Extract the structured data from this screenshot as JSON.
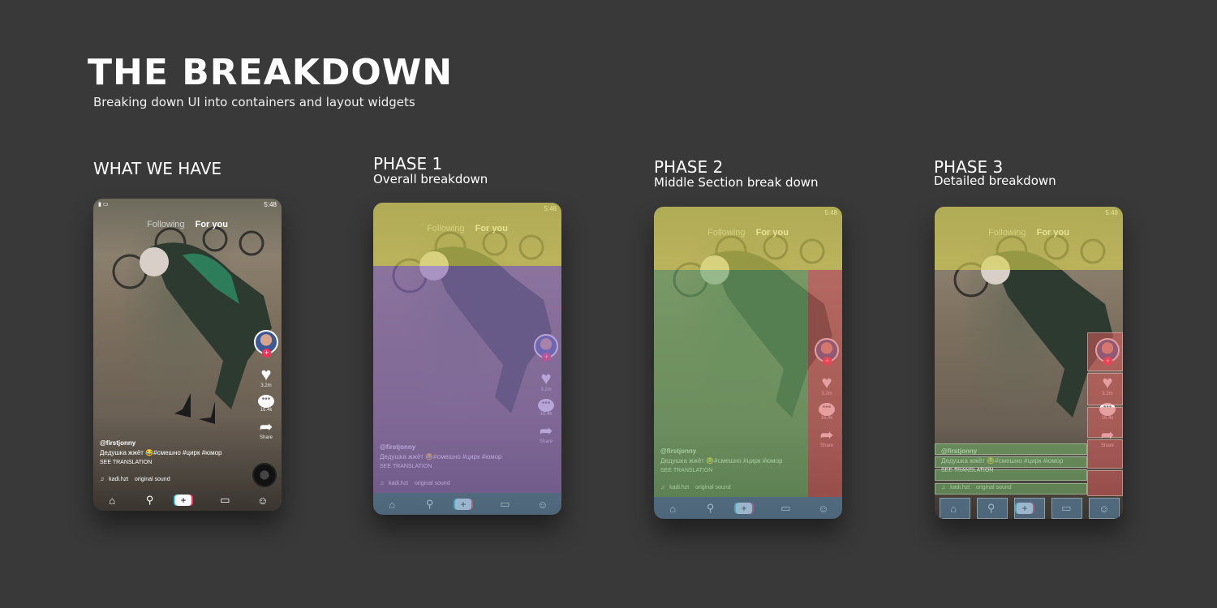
{
  "header": {
    "title": "THE BREAKDOWN",
    "subtitle": "Breaking down UI into containers and layout widgets"
  },
  "columns": [
    {
      "heading": "WHAT WE HAVE",
      "sub": ""
    },
    {
      "heading": "PHASE 1",
      "sub": "Overall breakdown"
    },
    {
      "heading": "PHASE 2",
      "sub": "Middle Section break down"
    },
    {
      "heading": "PHASE 3",
      "sub": "Detailed breakdown"
    }
  ],
  "phone": {
    "time": "5:48",
    "tab_following": "Following",
    "tab_for_you": "For you",
    "likes": "3.2m",
    "comments": "16.4k",
    "share": "Share",
    "username": "@firstjonny",
    "caption": "Дедушка жжёт 😂#смешно #цирк #юмор",
    "see_translation": "SEE TRANSLATION",
    "music_user": "kadi.hzt",
    "music_label": "original sound"
  },
  "colors": {
    "background": "#393939",
    "yellow_overlay": "#d8d250",
    "purple_overlay": "#8c6ebe",
    "green_overlay": "#6eaa64",
    "red_overlay": "#d25a5a",
    "blue_overlay": "#5a87aa"
  },
  "icons": [
    "home-icon",
    "search-icon",
    "plus-icon",
    "inbox-icon",
    "profile-icon",
    "heart-icon",
    "comment-icon",
    "share-icon",
    "music-note-icon"
  ]
}
